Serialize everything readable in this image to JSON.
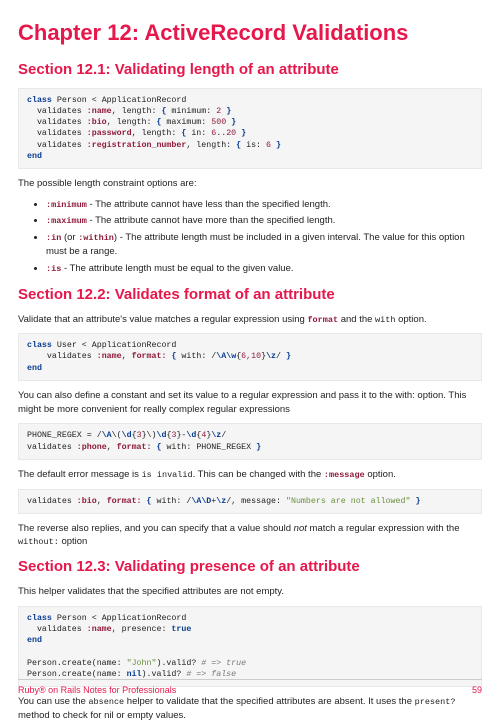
{
  "chapter_title": "Chapter 12: ActiveRecord Validations",
  "sections": {
    "s1": {
      "title": "Section 12.1: Validating length of an attribute",
      "intro_after": "The possible length constraint options are:",
      "bullets": {
        "b1_code": ":minimum",
        "b1_txt": " - The attribute cannot have less than the specified length.",
        "b2_code": ":maximum",
        "b2_txt": " - The attribute cannot have more than the specified length.",
        "b3_code": ":in",
        "b3_paren": " (or ",
        "b3_code2": ":within",
        "b3_txt": ") - The attribute length must be included in a given interval. The value for this option must be a range.",
        "b4_code": ":is",
        "b4_txt": " - The attribute length must be equal to the given value."
      }
    },
    "s2": {
      "title": "Section 12.2: Validates format of an attribute",
      "p1a": "Validate that an attribute's value matches a regular expression using ",
      "p1code": "format",
      "p1b": " and the ",
      "p1c": "with",
      "p1d": " option.",
      "p2": "You can also define a constant and set its value to a regular expression and pass it to the with: option. This might be more convenient for really complex regular expressions",
      "p3a": "The default error message is ",
      "p3code": "is invalid",
      "p3b": ". This can be changed with the ",
      "p3code2": ":message",
      "p3c": " option.",
      "p4a": "The reverse also replies, and you can specify that a value should ",
      "p4i": "not",
      "p4b": " match a regular expression with the ",
      "p4c": "without:",
      "p4d": " option"
    },
    "s3": {
      "title": "Section 12.3: Validating presence of an attribute",
      "p1": "This helper validates that the specified attributes are not empty.",
      "p2a": "You can use the ",
      "p2code1": "absence",
      "p2b": " helper to validate that the specified attributes are absent. It uses the ",
      "p2code2": "present?",
      "p2c": " method to check for nil or empty values."
    }
  },
  "footer": {
    "left": "Ruby® on Rails Notes for Professionals",
    "right": "59"
  }
}
